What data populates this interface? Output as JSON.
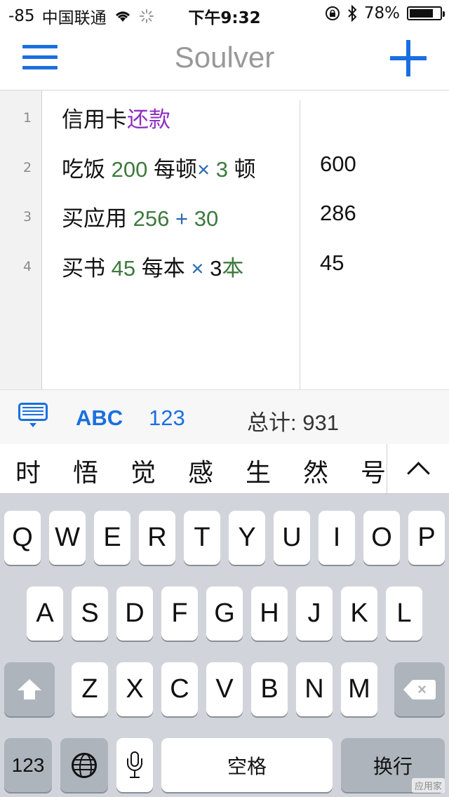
{
  "status_bar": {
    "signal": "-85",
    "carrier": "中国联通",
    "time": "下午9:32",
    "battery": "78%",
    "battery_level": 0.78
  },
  "nav": {
    "title": "Soulver"
  },
  "editor": {
    "lines": [
      {
        "num": "1",
        "segments": [
          {
            "t": "信用卡",
            "c": "plain"
          },
          {
            "t": "还款",
            "c": "purple"
          }
        ],
        "answer": ""
      },
      {
        "num": "2",
        "segments": [
          {
            "t": "吃饭 ",
            "c": "plain"
          },
          {
            "t": "200",
            "c": "green"
          },
          {
            "t": " 每顿",
            "c": "plain"
          },
          {
            "t": "×",
            "c": "op"
          },
          {
            "t": " 3",
            "c": "green"
          },
          {
            "t": " 顿",
            "c": "plain"
          }
        ],
        "answer": "600"
      },
      {
        "num": "3",
        "segments": [
          {
            "t": "买应用 ",
            "c": "plain"
          },
          {
            "t": "256",
            "c": "green"
          },
          {
            "t": " + ",
            "c": "op"
          },
          {
            "t": "30",
            "c": "green"
          }
        ],
        "answer": "286"
      },
      {
        "num": "4",
        "segments": [
          {
            "t": "买书 ",
            "c": "plain"
          },
          {
            "t": "45",
            "c": "green"
          },
          {
            "t": " 每本 ",
            "c": "plain"
          },
          {
            "t": "×",
            "c": "op"
          },
          {
            "t": " 3",
            "c": "plain"
          },
          {
            "t": "本",
            "c": "green"
          }
        ],
        "answer": "45"
      }
    ]
  },
  "total_bar": {
    "abc_label": "ABC",
    "num_label": "123",
    "total_label": "总计:  931"
  },
  "candidates": [
    "时",
    "悟",
    "觉",
    "感",
    "生",
    "然",
    "号"
  ],
  "keyboard": {
    "row1": [
      "Q",
      "W",
      "E",
      "R",
      "T",
      "Y",
      "U",
      "I",
      "O",
      "P"
    ],
    "row2": [
      "A",
      "S",
      "D",
      "F",
      "G",
      "H",
      "J",
      "K",
      "L"
    ],
    "row3": [
      "Z",
      "X",
      "C",
      "V",
      "B",
      "N",
      "M"
    ],
    "numbers_label": "123",
    "space_label": "空格",
    "return_label": "换行"
  },
  "watermark": "应用家",
  "colors": {
    "accent": "#1a6fe0",
    "number_green": "#3d7a3d",
    "word_purple": "#8e2fc2",
    "operator_blue": "#2a6bb0"
  }
}
